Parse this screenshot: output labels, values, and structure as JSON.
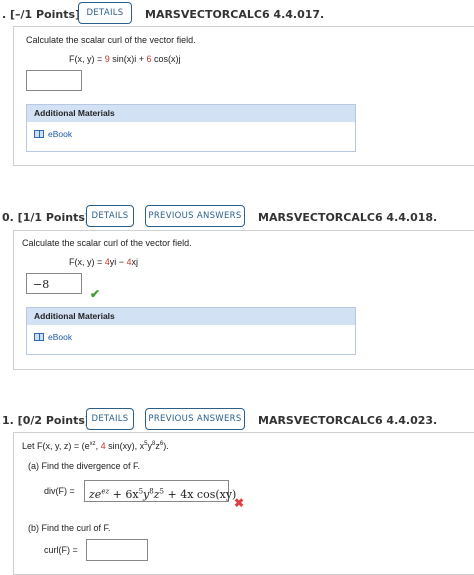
{
  "q1": {
    "points": ". [–/1 Points]",
    "details": "DETAILS",
    "code": "MARSVECTORCALC6 4.4.017.",
    "prompt": "Calculate the scalar curl of the vector field.",
    "field_prefix": "F(x, y) = ",
    "field_c1": "9",
    "field_mid": " sin(x)i + ",
    "field_c2": "6",
    "field_end": " cos(x)j",
    "answer": "",
    "additional_materials": "Additional Materials",
    "ebook": "eBook"
  },
  "q2": {
    "points": "0.  [1/1 Points]",
    "details": "DETAILS",
    "previous": "PREVIOUS ANSWERS",
    "code": "MARSVECTORCALC6 4.4.018.",
    "prompt": "Calculate the scalar curl of the vector field.",
    "field_prefix": "F(x, y) = ",
    "field_c1": "4",
    "field_mid": "yi − ",
    "field_c2": "4",
    "field_end": "xj",
    "answer": "−8",
    "additional_materials": "Additional Materials",
    "ebook": "eBook"
  },
  "q3": {
    "points": "1.  [0/2 Points]",
    "details": "DETAILS",
    "previous": "PREVIOUS ANSWERS",
    "code": "MARSVECTORCALC6 4.4.023.",
    "let_prefix": "Let F(x, y, z) = (e",
    "let_exp": "xz",
    "let_mid1": ", ",
    "let_c1": "4",
    "let_mid2": " sin(xy), x",
    "let_e1": "5",
    "let_y": "y",
    "let_e2": "8",
    "let_z": "z",
    "let_e3": "6",
    "let_end": ").",
    "part_a": "(a)   Find the divergence of F.",
    "div_label": "div(F) =",
    "div_answer_1": "ze",
    "div_answer_exp": "ez",
    "div_answer_2": " + 6x",
    "div_e1": "5",
    "div_y": "y",
    "div_e2": "8",
    "div_z": "z",
    "div_e3": "5",
    "div_answer_3": " + 4x cos(xy)",
    "part_b": "(b)   Find the curl of F.",
    "curl_label": "curl(F) =",
    "curl_answer": ""
  },
  "colors": {
    "accent": "#2b5f8a",
    "highlight": "#c0392b",
    "correct": "#3aa02f",
    "incorrect": "#e04040"
  }
}
